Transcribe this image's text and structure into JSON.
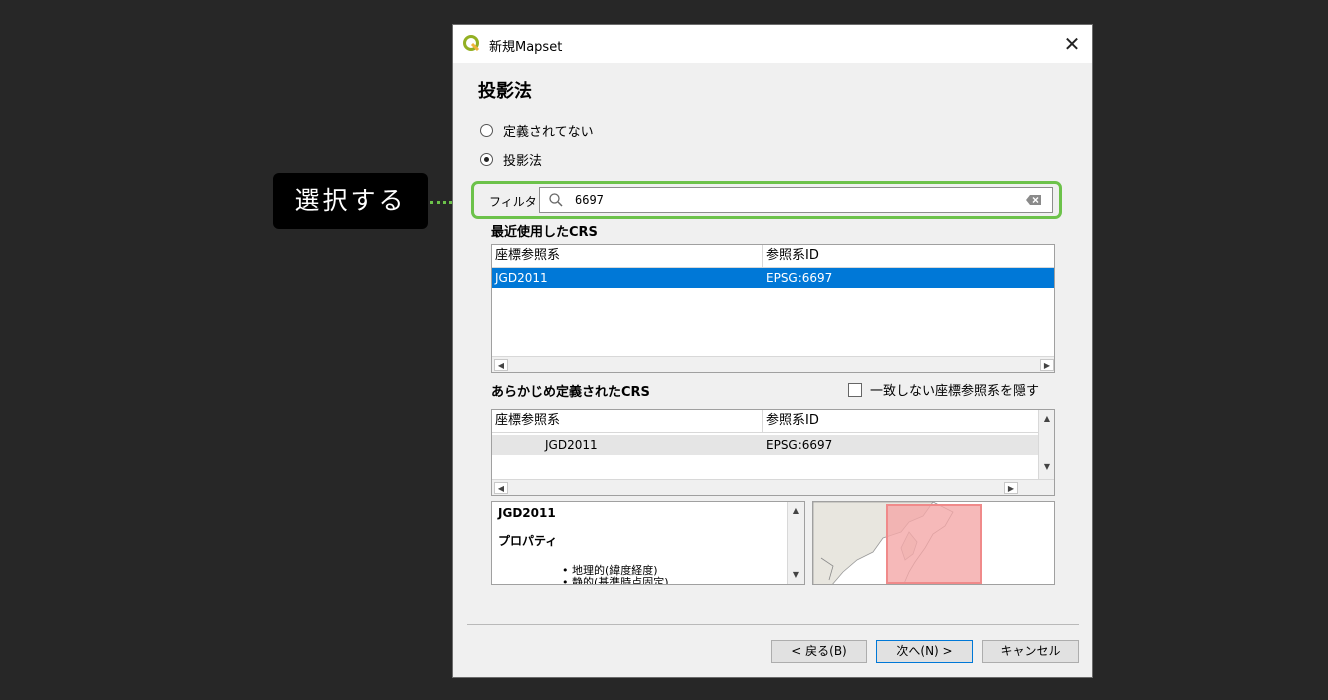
{
  "window": {
    "title": "新規Mapset",
    "close_symbol": "✕"
  },
  "page_heading": "投影法",
  "radios": [
    {
      "label": "定義されてない",
      "checked": false
    },
    {
      "label": "投影法",
      "checked": true
    }
  ],
  "filter": {
    "label": "フィルタ",
    "value": "6697"
  },
  "annotation": {
    "text": "選択する",
    "highlight_color": "#6cc24a"
  },
  "recent": {
    "title": "最近使用したCRS",
    "columns": [
      "座標参照系",
      "参照系ID"
    ],
    "rows": [
      {
        "crs": "JGD2011",
        "id": "EPSG:6697",
        "selected": true
      }
    ]
  },
  "predefined": {
    "title": "あらかじめ定義されたCRS",
    "hide_checkbox_label": "一致しない座標参照系を隠す",
    "columns": [
      "座標参照系",
      "参照系ID"
    ],
    "rows": [
      {
        "crs": "JGD2011",
        "id": "EPSG:6697"
      }
    ]
  },
  "details": {
    "name": "JGD2011",
    "properties_label": "プロパティ",
    "bullets": [
      "• 地理的(緯度経度)",
      "• 静的(基準時点固定)"
    ]
  },
  "buttons": {
    "back": "< 戻る(B)",
    "next": "次へ(N) >",
    "cancel": "キャンセル"
  },
  "colors": {
    "selection": "#0078d7",
    "map_extent": "#f4a7a7"
  }
}
